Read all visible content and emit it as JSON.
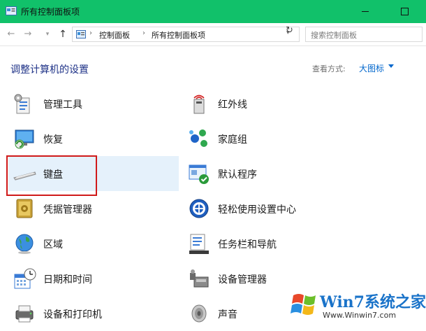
{
  "window": {
    "title": "所有控制面板项"
  },
  "navigation": {
    "back_glyph": "←",
    "forward_glyph": "→",
    "up_glyph": "↑",
    "breadcrumb": [
      "控制面板",
      "所有控制面板项"
    ],
    "search_placeholder": "搜索控制面板"
  },
  "content": {
    "heading": "调整计算机的设置",
    "view_by_label": "查看方式:",
    "view_by_value": "大图标"
  },
  "items_left": [
    {
      "label": "管理工具",
      "icon": "admin-tools-icon"
    },
    {
      "label": "恢复",
      "icon": "recovery-icon"
    },
    {
      "label": "键盘",
      "icon": "keyboard-icon",
      "selected": true
    },
    {
      "label": "凭据管理器",
      "icon": "credential-manager-icon"
    },
    {
      "label": "区域",
      "icon": "region-globe-icon"
    },
    {
      "label": "日期和时间",
      "icon": "date-time-icon"
    },
    {
      "label": "设备和打印机",
      "icon": "devices-printers-icon"
    }
  ],
  "items_right": [
    {
      "label": "红外线",
      "icon": "infrared-icon"
    },
    {
      "label": "家庭组",
      "icon": "homegroup-icon"
    },
    {
      "label": "默认程序",
      "icon": "default-programs-icon"
    },
    {
      "label": "轻松使用设置中心",
      "icon": "ease-of-access-icon"
    },
    {
      "label": "任务栏和导航",
      "icon": "taskbar-navigation-icon"
    },
    {
      "label": "设备管理器",
      "icon": "device-manager-icon"
    },
    {
      "label": "声音",
      "icon": "sound-speaker-icon"
    }
  ],
  "watermark": {
    "text": "Win7系统之家",
    "url": "Www.Winwin7.com"
  },
  "colors": {
    "titlebar": "#11c16a",
    "highlight": "#d01a1a",
    "link": "#0066cc",
    "heading": "#1e3287"
  }
}
